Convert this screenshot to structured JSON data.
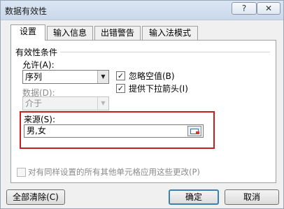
{
  "window": {
    "title": "数据有效性",
    "help_label": "?",
    "close_label": "✕"
  },
  "tabs": [
    {
      "label": "设置"
    },
    {
      "label": "输入信息"
    },
    {
      "label": "出错警告"
    },
    {
      "label": "输入法模式"
    }
  ],
  "settings": {
    "group_title": "有效性条件",
    "allow_label": "允许(A):",
    "allow_value": "序列",
    "data_label": "数据(D):",
    "data_value": "介于",
    "ignore_blank_label": "忽略空值(B)",
    "ignore_blank_checked": true,
    "in_cell_dropdown_label": "提供下拉箭头(I)",
    "in_cell_dropdown_checked": true,
    "source_label": "来源(S):",
    "source_value": "男,女",
    "apply_all_label": "对有同样设置的所有其他单元格应用这些更改(P)",
    "apply_all_checked": false
  },
  "buttons": {
    "clear_all": "全部清除(C)",
    "ok": "确定",
    "cancel": "取消"
  },
  "colors": {
    "highlight": "#c81e1e",
    "default_button_border": "#3c7fb1"
  },
  "icons": {
    "dropdown": "chevron-down-icon",
    "range_picker": "range-select-icon",
    "check": "checkmark-icon"
  }
}
